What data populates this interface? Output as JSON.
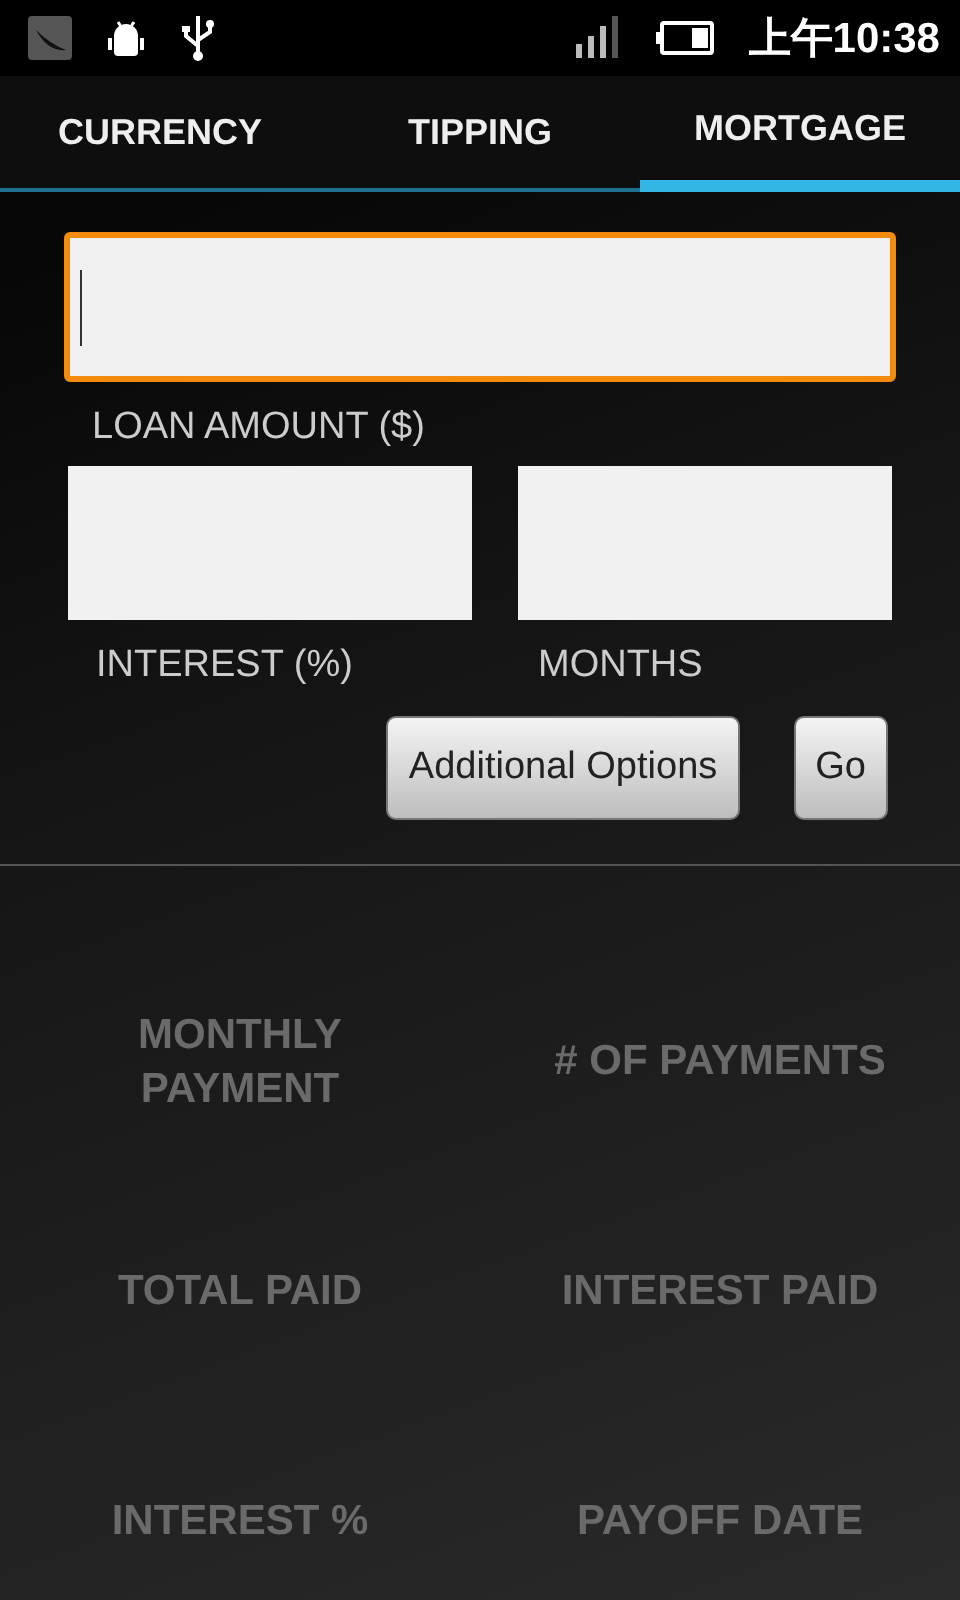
{
  "status_bar": {
    "time": "上午10:38"
  },
  "tabs": [
    {
      "label": "CURRENCY",
      "selected": false
    },
    {
      "label": "TIPPING",
      "selected": false
    },
    {
      "label": "MORTGAGE",
      "selected": true
    }
  ],
  "loan_field": {
    "label": "LOAN AMOUNT ($)",
    "focused": true
  },
  "small_fields": [
    {
      "label": "INTEREST (%)",
      "focused": false
    },
    {
      "label": "MONTHS",
      "focused": false
    }
  ],
  "buttons": [
    "Additional Options",
    "Go"
  ],
  "results": [
    "MONTHLY PAYMENT",
    "# OF PAYMENTS",
    "TOTAL PAID",
    "INTEREST PAID",
    "INTEREST %",
    "PAYOFF DATE"
  ]
}
